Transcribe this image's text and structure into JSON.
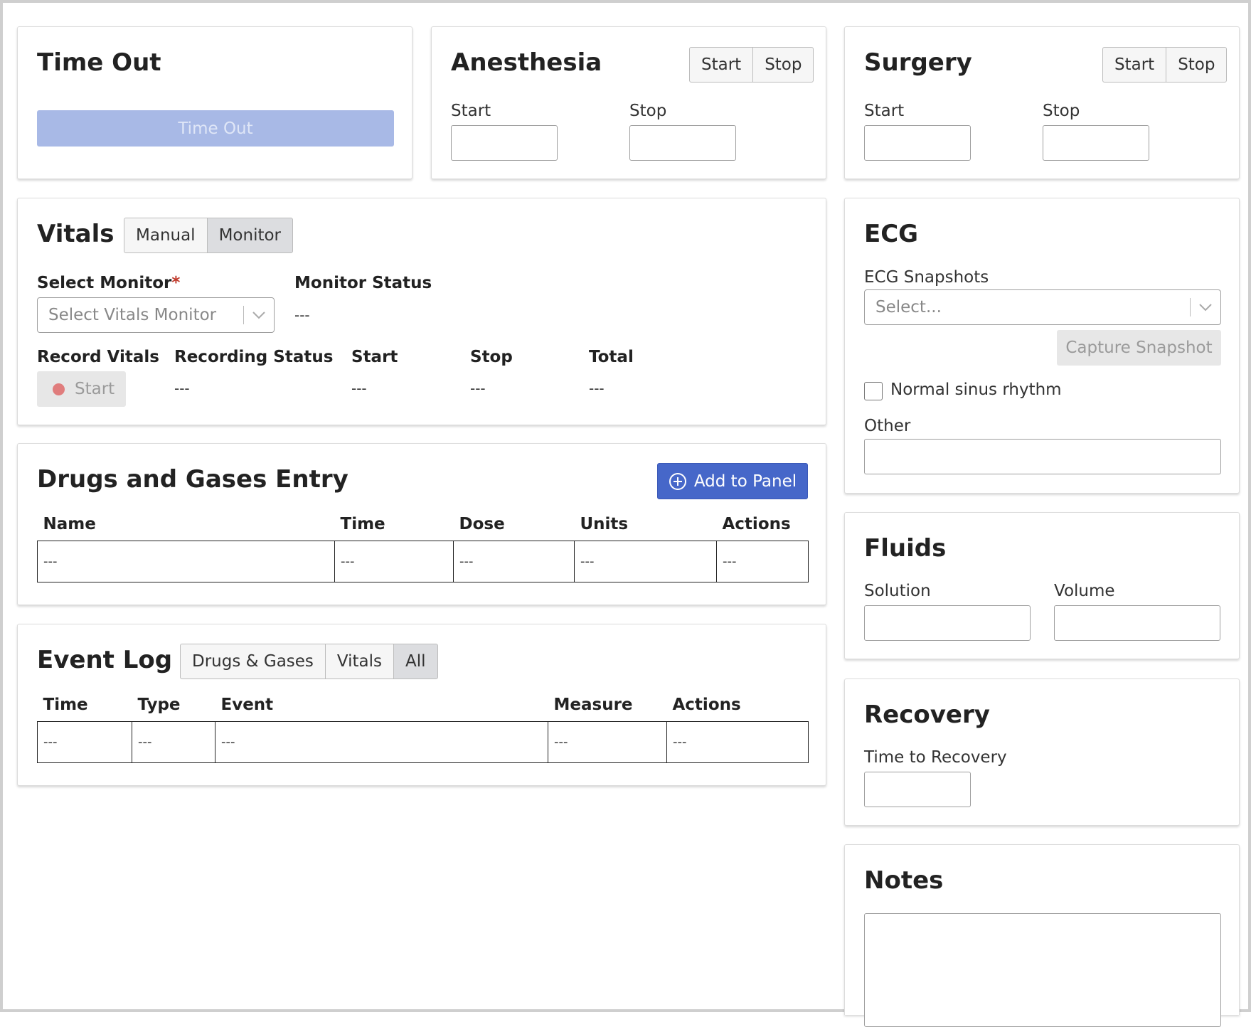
{
  "time_out": {
    "title": "Time Out",
    "button_label": "Time Out"
  },
  "anesthesia": {
    "title": "Anesthesia",
    "start_btn": "Start",
    "stop_btn": "Stop",
    "start_label": "Start",
    "stop_label": "Stop"
  },
  "surgery": {
    "title": "Surgery",
    "start_btn": "Start",
    "stop_btn": "Stop",
    "start_label": "Start",
    "stop_label": "Stop"
  },
  "vitals": {
    "title": "Vitals |",
    "mode_manual": "Manual",
    "mode_monitor": "Monitor",
    "active_mode": "Monitor",
    "select_monitor_label": "Select Monitor",
    "required_mark": "*",
    "select_placeholder": "Select Vitals Monitor",
    "monitor_status_label": "Monitor Status",
    "monitor_status_value": "---",
    "record_vitals_label": "Record Vitals",
    "record_button": "Start",
    "recording_status_label": "Recording Status",
    "recording_status_value": "---",
    "start_label": "Start",
    "start_value": "---",
    "stop_label": "Stop",
    "stop_value": "---",
    "total_label": "Total",
    "total_value": "---",
    "record_dot_color": "#e07d7d"
  },
  "drugs": {
    "title": "Drugs and Gases Entry",
    "add_button": "Add to Panel",
    "columns": [
      "Name",
      "Time",
      "Dose",
      "Units",
      "Actions"
    ],
    "row": [
      "---",
      "---",
      "---",
      "---",
      "---"
    ]
  },
  "event_log": {
    "title": "Event Log |",
    "filter_drugs": "Drugs & Gases",
    "filter_vitals": "Vitals",
    "filter_all": "All",
    "active_filter": "All",
    "columns": [
      "Time",
      "Type",
      "Event",
      "Measure",
      "Actions"
    ],
    "row": [
      "---",
      "---",
      "---",
      "---",
      "---"
    ]
  },
  "ecg": {
    "title": "ECG",
    "snapshots_label": "ECG Snapshots",
    "select_placeholder": "Select...",
    "capture_button": "Capture Snapshot",
    "normal_sinus_label": "Normal sinus rhythm",
    "other_label": "Other"
  },
  "fluids": {
    "title": "Fluids",
    "solution_label": "Solution",
    "volume_label": "Volume"
  },
  "recovery": {
    "title": "Recovery",
    "time_label": "Time to Recovery"
  },
  "notes": {
    "title": "Notes"
  },
  "colors": {
    "primary": "#4667c9",
    "timeout_disabled_bg": "#a8b9e6",
    "border": "#dcdcdc"
  }
}
